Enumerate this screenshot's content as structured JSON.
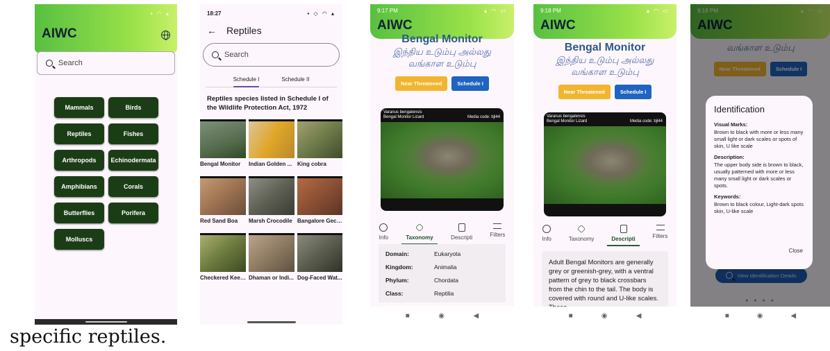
{
  "screen1": {
    "app_title": "AIWC",
    "search_placeholder": "Search",
    "categories": [
      "Mammals",
      "Birds",
      "Reptiles",
      "Fishes",
      "Arthropods",
      "Echinodermata",
      "Amphibians",
      "Corals",
      "Butterflies",
      "Porifera",
      "Molluscs"
    ]
  },
  "screen2": {
    "time": "18:27",
    "title": "Reptiles",
    "search_placeholder": "Search",
    "tabs": [
      "Schedule I",
      "Schedule II"
    ],
    "caption": "Reptiles species listed in Schedule I of the Wildlife Protection Act, 1972",
    "species": [
      "Bengal Monitor",
      "Indian Golden ...",
      "King cobra",
      "Red Sand Boa",
      "Marsh Crocodile",
      "Bangalore Geck...",
      "Checkered Keel...",
      "Dhaman or Indi...",
      "Dog-Faced Wat..."
    ]
  },
  "screen3": {
    "time": "9:17 PM",
    "app_title": "AIWC",
    "name": "Bengal Monitor",
    "tamil_name": "இந்திய உடும்பு அல்லது வங்காள உடும்பு",
    "status_badge": "Near Threatened",
    "schedule_badge": "Schedule I",
    "photo_sci": "Varanus bengalensis",
    "photo_common": "Bengal Monitor Lizard",
    "media_code": "Media code: bjl44",
    "tabs": [
      "Info",
      "Taxonomy",
      "Descripti",
      "Filters"
    ],
    "taxonomy": [
      {
        "k": "Domain:",
        "v": "Eukaryota"
      },
      {
        "k": "Kingdom:",
        "v": "Animalia"
      },
      {
        "k": "Phylum:",
        "v": "Chordata"
      },
      {
        "k": "Class:",
        "v": "Reptilia"
      }
    ]
  },
  "screen4": {
    "time": "9:18 PM",
    "app_title": "AIWC",
    "name": "Bengal Monitor",
    "tamil_name": "இந்திய உடும்பு அல்லது வங்காள உடும்பு",
    "status_badge": "Near Threatened",
    "schedule_badge": "Schedule I",
    "photo_sci": "Varanus bengalensis",
    "photo_common": "Bengal Monitor Lizard",
    "media_code": "Media code: bjl44",
    "tabs": [
      "Info",
      "Taxonomy",
      "Descripti",
      "Filters"
    ],
    "description": "Adult Bengal Monitors are generally grey or greenish-grey, with a ventral pattern of grey to black crossbars from the chin to the tail. The body is covered with round and U-like scales. These"
  },
  "screen5": {
    "time": "9:18 PM",
    "app_title": "AIWC",
    "tamil_partial": "வங்காள உடும்பு",
    "status_badge": "Near Threatened",
    "schedule_badge": "Schedule I",
    "dialog": {
      "title": "Identification",
      "visual_marks_h": "Visual Marks:",
      "visual_marks": "Brown to black with more or less many small light or dark scales or spots of skin, U like scale",
      "description_h": "Description:",
      "description": "The upper body side is brown to black, usually patterned with more or less many small light or dark scales or spots.",
      "keywords_h": "Keywords:",
      "keywords": "Brown to black colour, Light-dark spots skin, U-like scale",
      "close": "Close"
    },
    "view_button": "View Identification Details"
  },
  "footer": "specific reptiles."
}
